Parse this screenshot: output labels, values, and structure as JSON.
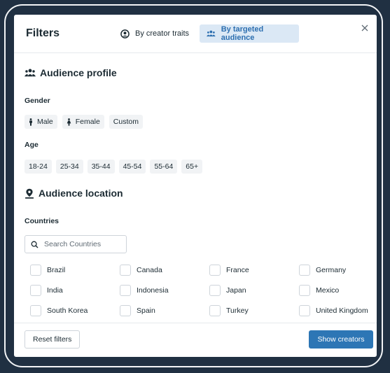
{
  "header": {
    "title": "Filters",
    "tabs": [
      {
        "label": "By creator traits",
        "icon": "user-circle-icon",
        "active": false
      },
      {
        "label": "By targeted audience",
        "icon": "people-icon",
        "active": true
      }
    ],
    "close_icon": "close-icon"
  },
  "audience_profile": {
    "title": "Audience profile",
    "icon": "people-icon",
    "gender": {
      "label": "Gender",
      "options": [
        {
          "label": "Male",
          "icon": "male-icon"
        },
        {
          "label": "Female",
          "icon": "female-icon"
        },
        {
          "label": "Custom"
        }
      ]
    },
    "age": {
      "label": "Age",
      "options": [
        "18-24",
        "25-34",
        "35-44",
        "45-54",
        "55-64",
        "65+"
      ]
    }
  },
  "audience_location": {
    "title": "Audience location",
    "icon": "location-pin-icon",
    "countries": {
      "label": "Countries",
      "search_placeholder": "Search Countries",
      "items": [
        "Brazil",
        "Canada",
        "France",
        "Germany",
        "India",
        "Indonesia",
        "Japan",
        "Mexico",
        "South Korea",
        "Spain",
        "Turkey",
        "United Kingdom"
      ]
    }
  },
  "footer": {
    "reset_label": "Reset filters",
    "show_label": "Show creators"
  },
  "colors": {
    "background": "#203042",
    "accent": "#2d76b5",
    "active_tab_bg": "#dbe8f5",
    "active_tab_text": "#2d6fb0",
    "text": "#1c2b33"
  }
}
